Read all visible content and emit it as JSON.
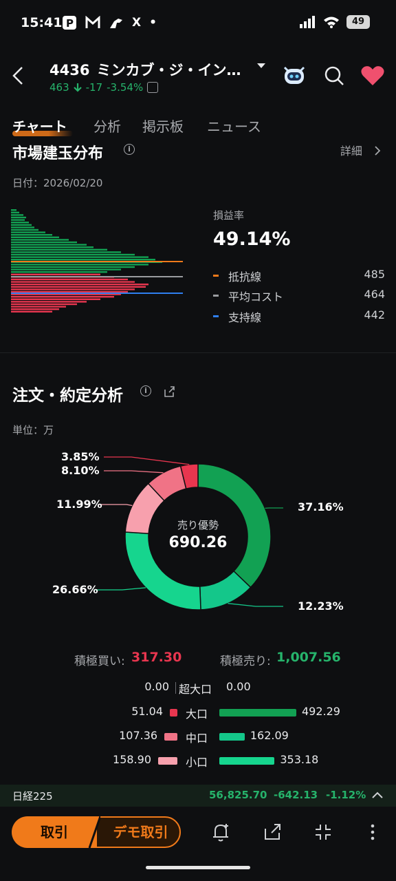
{
  "status": {
    "time": "15:41",
    "battery": "49",
    "x_icon": "X",
    "dot": "•"
  },
  "header": {
    "code": "4436",
    "name": "ミンカブ・ジ・イン…",
    "price": "463",
    "change": "-17",
    "change_pct": "-3.54%"
  },
  "tabs": [
    {
      "label": "チャート",
      "active": true
    },
    {
      "label": "分析"
    },
    {
      "label": "掲示板"
    },
    {
      "label": "ニュース"
    }
  ],
  "market_section": {
    "title": "市場建玉分布",
    "detail": "詳細",
    "date": "日付：2026/02/20",
    "pl_label": "損益率",
    "pl_value": "49.14%",
    "legend": [
      {
        "name": "抵抗線",
        "value": "485",
        "color": "#f07a1a"
      },
      {
        "name": "平均コスト",
        "value": "464",
        "color": "#9a9ca0"
      },
      {
        "name": "支持線",
        "value": "442",
        "color": "#2f7ff0"
      }
    ]
  },
  "order_section": {
    "title": "注文・約定分析",
    "unit": "単位：万",
    "center_label": "売り優勢",
    "center_value": "690.26",
    "slices": [
      {
        "label": "37.16%",
        "pct": 37.16,
        "color": "#12a153"
      },
      {
        "label": "12.23%",
        "pct": 12.23,
        "color": "#14c78a"
      },
      {
        "label": "26.66%",
        "pct": 26.66,
        "color": "#16d58e"
      },
      {
        "label": "11.99%",
        "pct": 11.99,
        "color": "#f7a0ad"
      },
      {
        "label": "8.10%",
        "pct": 8.1,
        "color": "#f07386"
      },
      {
        "label": "3.85%",
        "pct": 3.85,
        "color": "#e8364f"
      }
    ],
    "buy_label": "積極買い:",
    "buy_value": "317.30",
    "sell_label": "積極売り:",
    "sell_value": "1,007.56",
    "rows": [
      {
        "name": "超大口",
        "buy": "0.00",
        "sell": "0.00",
        "buy_num": 0,
        "sell_num": 0,
        "buy_color": "#e8364f",
        "sell_color": "#12a153"
      },
      {
        "name": "大口",
        "buy": "51.04",
        "sell": "492.29",
        "buy_num": 51.04,
        "sell_num": 492.29,
        "buy_color": "#e8364f",
        "sell_color": "#12a153"
      },
      {
        "name": "中口",
        "buy": "107.36",
        "sell": "162.09",
        "buy_num": 107.36,
        "sell_num": 162.09,
        "buy_color": "#f07386",
        "sell_color": "#14c78a"
      },
      {
        "name": "小口",
        "buy": "158.90",
        "sell": "353.18",
        "buy_num": 158.9,
        "sell_num": 353.18,
        "buy_color": "#f7a0ad",
        "sell_color": "#16d58e"
      }
    ]
  },
  "ticker": {
    "name": "日経225",
    "value": "56,825.70",
    "change": "-642.13",
    "pct": "-1.12%"
  },
  "bottom": {
    "trade": "取引",
    "demo": "デモ取引"
  }
}
